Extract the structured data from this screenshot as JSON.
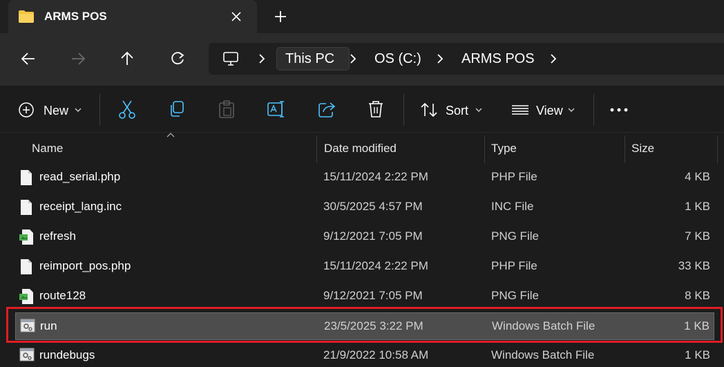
{
  "tab": {
    "title": "ARMS POS",
    "close_icon": "close-icon",
    "new_tab_icon": "plus-icon"
  },
  "nav": {
    "back_icon": "arrow-left-icon",
    "forward_icon": "arrow-right-icon",
    "up_icon": "arrow-up-icon",
    "refresh_icon": "refresh-icon"
  },
  "breadcrumb": [
    "This PC",
    "OS (C:)",
    "ARMS POS"
  ],
  "toolbar": {
    "new_label": "New",
    "sort_label": "Sort",
    "view_label": "View",
    "icons": [
      "cut-icon",
      "copy-icon",
      "paste-icon",
      "rename-icon",
      "share-icon",
      "delete-icon",
      "more-icon"
    ]
  },
  "columns": {
    "name": "Name",
    "date": "Date modified",
    "type": "Type",
    "size": "Size"
  },
  "files": [
    {
      "name": "read_serial.php",
      "date": "15/11/2024 2:22 PM",
      "type": "PHP File",
      "size": "4 KB",
      "icon": "file-icon"
    },
    {
      "name": "receipt_lang.inc",
      "date": "30/5/2025 4:57 PM",
      "type": "INC File",
      "size": "1 KB",
      "icon": "file-icon"
    },
    {
      "name": "refresh",
      "date": "9/12/2021 7:05 PM",
      "type": "PNG File",
      "size": "7 KB",
      "icon": "image-file-icon"
    },
    {
      "name": "reimport_pos.php",
      "date": "15/11/2024 2:22 PM",
      "type": "PHP File",
      "size": "33 KB",
      "icon": "file-icon"
    },
    {
      "name": "route128",
      "date": "9/12/2021 7:05 PM",
      "type": "PNG File",
      "size": "8 KB",
      "icon": "image-file-icon"
    },
    {
      "name": "run",
      "date": "23/5/2025 3:22 PM",
      "type": "Windows Batch File",
      "size": "1 KB",
      "icon": "batch-file-icon",
      "selected": true
    },
    {
      "name": "rundebugs",
      "date": "21/9/2022 10:58 AM",
      "type": "Windows Batch File",
      "size": "1 KB",
      "icon": "batch-file-icon"
    }
  ],
  "colors": {
    "highlight": "#e01c24",
    "selected_row": "#4d4d4d"
  }
}
